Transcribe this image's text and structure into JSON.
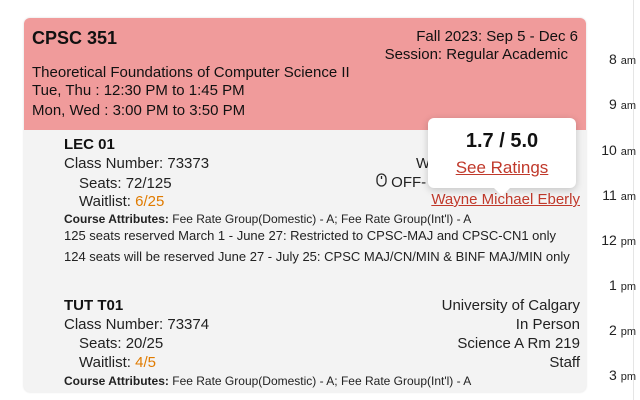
{
  "course": {
    "code": "CPSC 351",
    "term": "Fall 2023: Sep 5 - Dec 6",
    "session": "Session: Regular Academic",
    "title": "Theoretical Foundations of Computer Science II",
    "schedule": [
      "Tue, Thu : 12:30 PM to 1:45 PM",
      "Mon, Wed : 3:00 PM to 3:50 PM"
    ],
    "header_color": "#f09b9b"
  },
  "sections": [
    {
      "title": "LEC 01",
      "class_number": "Class Number: 73373",
      "seats_label": "Seats: 72/125",
      "waitlist_label": "Waitlist: ",
      "waitlist_value": "6/25",
      "right_partial_1": "W",
      "right_partial_2": "OFF-",
      "instructor": "Wayne Michael Eberly",
      "attributes_label": "Course Attributes:",
      "attributes_value": " Fee Rate Group(Domestic) - A; Fee Rate Group(Int'l) - A",
      "notes": [
        "125 seats reserved March 1 - June 27: Restricted to CPSC-MAJ and CPSC-CN1 only",
        "124 seats will be reserved June 27 - July 25: CPSC MAJ/CN/MIN & BINF MAJ/MIN only"
      ]
    },
    {
      "title": "TUT T01",
      "class_number": "Class Number: 73374",
      "seats_label": "Seats: 20/25",
      "waitlist_label": "Waitlist: ",
      "waitlist_value": "4/5",
      "location": [
        "University of Calgary",
        "In Person",
        "Science A Rm 219",
        "Staff"
      ],
      "attributes_label": "Course Attributes:",
      "attributes_value": " Fee Rate Group(Domestic) - A; Fee Rate Group(Int'l) - A"
    }
  ],
  "popup": {
    "rating": "1.7 / 5.0",
    "link": "See Ratings"
  },
  "timeline": [
    {
      "num": "8",
      "ampm": "am"
    },
    {
      "num": "9",
      "ampm": "am"
    },
    {
      "num": "10",
      "ampm": "am"
    },
    {
      "num": "11",
      "ampm": "am"
    },
    {
      "num": "12",
      "ampm": "pm"
    },
    {
      "num": "1",
      "ampm": "pm"
    },
    {
      "num": "2",
      "ampm": "pm"
    },
    {
      "num": "3",
      "ampm": "pm"
    }
  ],
  "colors": {
    "waitlist": "#e07b00",
    "link": "#c0392b"
  },
  "icons": {
    "mouse": "mouse-icon"
  }
}
